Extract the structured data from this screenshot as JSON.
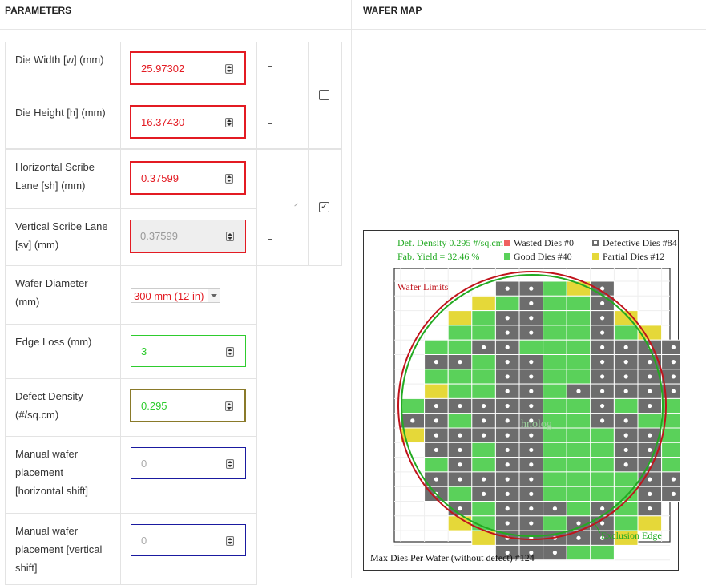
{
  "headers": {
    "parameters": "PARAMETERS",
    "wafer_map": "WAFER MAP"
  },
  "fields": {
    "die_width": {
      "label": "Die Width [w] (mm)",
      "value": "25.97302"
    },
    "die_height": {
      "label": "Die Height [h] (mm)",
      "value": "16.37430"
    },
    "horizontal_scribe": {
      "label": "Horizontal Scribe Lane [sh] (mm)",
      "value": "0.37599"
    },
    "vertical_scribe": {
      "label": "Vertical Scribe Lane [sv] (mm)",
      "value": "0.37599"
    },
    "wafer_diameter": {
      "label": "Wafer Diameter (mm)",
      "value": "300 mm (12 in)"
    },
    "edge_loss": {
      "label": "Edge Loss (mm)",
      "value": "3"
    },
    "defect_density": {
      "label": "Defect Density (#/sq.cm)",
      "value": "0.295"
    },
    "manual_h": {
      "label": "Manual wafer placement [horizontal shift]",
      "placeholder": "0"
    },
    "manual_v": {
      "label": "Manual wafer placement [vertical shift]",
      "placeholder": "0"
    }
  },
  "checkboxes": {
    "lock_aspect": false,
    "lock_scribe": true
  },
  "wafer_map": {
    "def_density": "Def. Density 0.295 #/sq.cm",
    "fab_yield": "Fab. Yield = 32.46 %",
    "wasted": "Wasted Dies  #0",
    "good": "Good Dies #40",
    "defective": "Defective Dies  #84",
    "partial": "Partial Dies #12",
    "wafer_limits": "Wafer Limits",
    "exclusion_edge": "Exclusion Edge",
    "max_dies": "Max Dies Per Wafer (without defect) #124",
    "watermark": "hnolog",
    "colors": {
      "good": "#5ad15a",
      "defective": "#6d6d6d",
      "partial": "#e5d839",
      "wasted": "#f06060",
      "wafer_limit": "#c0141c",
      "exclusion": "#22aa22"
    },
    "rows": [
      "....DDGPD....",
      "...PGDGGD....",
      "..PGDDGGDP...",
      "..GGDDGGDGP..",
      ".GGDDGGGDDDD.",
      ".DDGDDGGDDDD.",
      ".GGGDDGGDDDD.",
      ".PGGDDGDDDDDP",
      "GDDDDDGGDGDGG",
      "DDGDDDGGDDGGG",
      "PDDDDDGGGDDGP",
      ".DDGDDGGGDDG.",
      ".GDGDDGGGDDG.",
      ".DDDDDGGGGDD.",
      ".DGDDDGGGGDD.",
      "..DGDDDGDGD..",
      "..PGDDGDDGP..",
      "...PDDDDDP...",
      "....DDDGG...."
    ]
  }
}
